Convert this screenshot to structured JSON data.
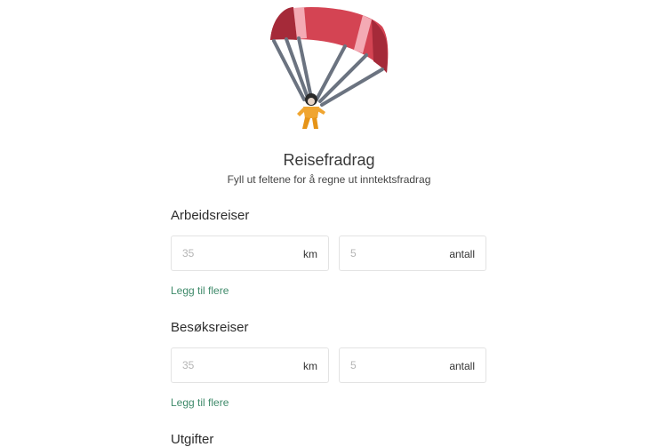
{
  "header": {
    "title": "Reisefradrag",
    "subtitle": "Fyll ut feltene for å regne ut inntektsfradrag",
    "illustration_icon": "parachute-icon"
  },
  "sections": [
    {
      "heading": "Arbeidsreiser",
      "distance": {
        "value": "",
        "placeholder": "35",
        "unit": "km"
      },
      "count": {
        "value": "",
        "placeholder": "5",
        "unit": "antall"
      },
      "add_more_label": "Legg til flere"
    },
    {
      "heading": "Besøksreiser",
      "distance": {
        "value": "",
        "placeholder": "35",
        "unit": "km"
      },
      "count": {
        "value": "",
        "placeholder": "5",
        "unit": "antall"
      },
      "add_more_label": "Legg til flere"
    },
    {
      "heading": "Utgifter"
    }
  ],
  "colors": {
    "accent_link": "#3f8a6a",
    "canopy_red": "#d44453",
    "canopy_dark": "#a52a39",
    "canopy_pink": "#f4aab4",
    "jumper_orange": "#f0a530"
  }
}
